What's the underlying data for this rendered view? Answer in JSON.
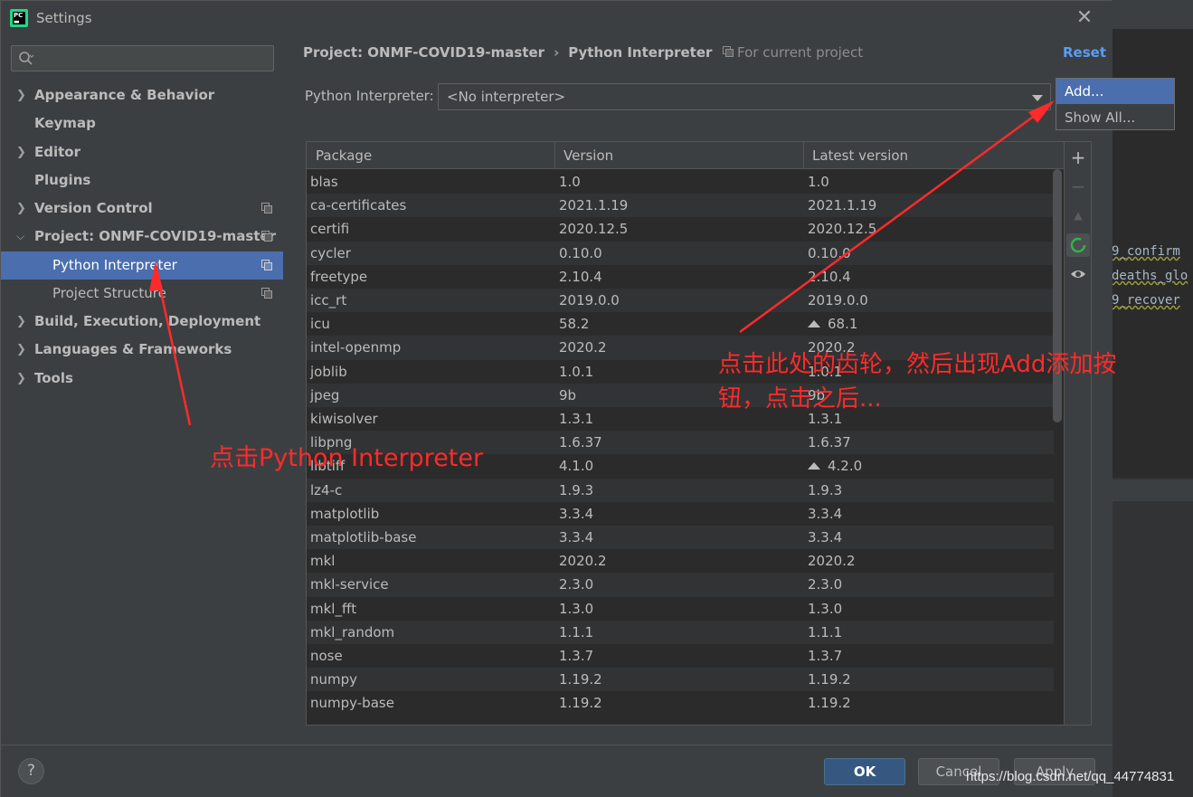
{
  "dialog": {
    "title": "Settings"
  },
  "search": {
    "placeholder": "",
    "value": ""
  },
  "sidebar": {
    "items": [
      {
        "label": "Appearance & Behavior",
        "expandable": true,
        "expanded": false
      },
      {
        "label": "Keymap",
        "expandable": false
      },
      {
        "label": "Editor",
        "expandable": true,
        "expanded": false
      },
      {
        "label": "Plugins",
        "expandable": false
      },
      {
        "label": "Version Control",
        "expandable": true,
        "expanded": false,
        "copy_icon": true
      },
      {
        "label": "Project: ONMF-COVID19-master",
        "expandable": true,
        "expanded": true,
        "copy_icon": true
      },
      {
        "label": "Python Interpreter",
        "child": true,
        "selected": true,
        "copy_icon": true
      },
      {
        "label": "Project Structure",
        "child": true,
        "copy_icon": true
      },
      {
        "label": "Build, Execution, Deployment",
        "expandable": true,
        "expanded": false
      },
      {
        "label": "Languages & Frameworks",
        "expandable": true,
        "expanded": false
      },
      {
        "label": "Tools",
        "expandable": true,
        "expanded": false
      }
    ]
  },
  "main": {
    "breadcrumb": [
      "Project: ONMF-COVID19-master",
      "Python Interpreter"
    ],
    "breadcrumb_sep": "›",
    "for_current_project": "For current project",
    "reset": "Reset",
    "interpreter_label": "Python Interpreter:",
    "interpreter_value": "<No interpreter>"
  },
  "table": {
    "columns": [
      "Package",
      "Version",
      "Latest version"
    ],
    "rows": [
      {
        "package": "blas",
        "version": "1.0",
        "latest": "1.0",
        "upgrade": false
      },
      {
        "package": "ca-certificates",
        "version": "2021.1.19",
        "latest": "2021.1.19",
        "upgrade": false
      },
      {
        "package": "certifi",
        "version": "2020.12.5",
        "latest": "2020.12.5",
        "upgrade": false
      },
      {
        "package": "cycler",
        "version": "0.10.0",
        "latest": "0.10.0",
        "upgrade": false
      },
      {
        "package": "freetype",
        "version": "2.10.4",
        "latest": "2.10.4",
        "upgrade": false
      },
      {
        "package": "icc_rt",
        "version": "2019.0.0",
        "latest": "2019.0.0",
        "upgrade": false
      },
      {
        "package": "icu",
        "version": "58.2",
        "latest": "68.1",
        "upgrade": true
      },
      {
        "package": "intel-openmp",
        "version": "2020.2",
        "latest": "2020.2",
        "upgrade": false
      },
      {
        "package": "joblib",
        "version": "1.0.1",
        "latest": "1.0.1",
        "upgrade": false
      },
      {
        "package": "jpeg",
        "version": "9b",
        "latest": "9b",
        "upgrade": false
      },
      {
        "package": "kiwisolver",
        "version": "1.3.1",
        "latest": "1.3.1",
        "upgrade": false
      },
      {
        "package": "libpng",
        "version": "1.6.37",
        "latest": "1.6.37",
        "upgrade": false
      },
      {
        "package": "libtiff",
        "version": "4.1.0",
        "latest": "4.2.0",
        "upgrade": true
      },
      {
        "package": "lz4-c",
        "version": "1.9.3",
        "latest": "1.9.3",
        "upgrade": false
      },
      {
        "package": "matplotlib",
        "version": "3.3.4",
        "latest": "3.3.4",
        "upgrade": false
      },
      {
        "package": "matplotlib-base",
        "version": "3.3.4",
        "latest": "3.3.4",
        "upgrade": false
      },
      {
        "package": "mkl",
        "version": "2020.2",
        "latest": "2020.2",
        "upgrade": false
      },
      {
        "package": "mkl-service",
        "version": "2.3.0",
        "latest": "2.3.0",
        "upgrade": false
      },
      {
        "package": "mkl_fft",
        "version": "1.3.0",
        "latest": "1.3.0",
        "upgrade": false
      },
      {
        "package": "mkl_random",
        "version": "1.1.1",
        "latest": "1.1.1",
        "upgrade": false
      },
      {
        "package": "nose",
        "version": "1.3.7",
        "latest": "1.3.7",
        "upgrade": false
      },
      {
        "package": "numpy",
        "version": "1.19.2",
        "latest": "1.19.2",
        "upgrade": false
      },
      {
        "package": "numpy-base",
        "version": "1.19.2",
        "latest": "1.19.2",
        "upgrade": false
      }
    ]
  },
  "toolbar": {
    "add": "+",
    "remove": "−",
    "upgrade": "▲",
    "eye": "◉"
  },
  "popup": {
    "items": [
      "Add...",
      "Show All..."
    ]
  },
  "footer": {
    "help": "?",
    "ok": "OK",
    "cancel": "Cancel",
    "apply": "Apply"
  },
  "background_editor": {
    "lines": [
      "9_confirm",
      "deaths_glo",
      "9_recover"
    ]
  },
  "annotations": {
    "left": "点击Python Interpreter",
    "right_line1": "点击此处的齿轮，然后出现Add添加按",
    "right_line2": "钮，点击之后..."
  },
  "watermark": "https://blog.csdn.net/qq_44774831",
  "colors": {
    "selection": "#4b6eaf",
    "link": "#589df6",
    "annotation": "#ff2a2a",
    "primary_button": "#365880"
  }
}
